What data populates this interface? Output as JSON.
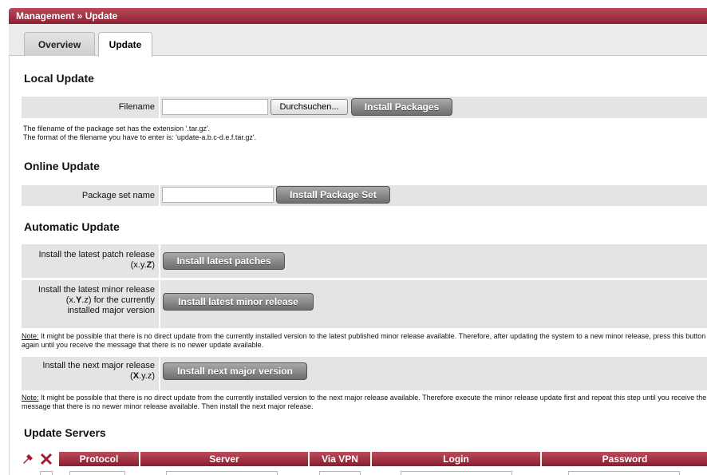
{
  "breadcrumb": "Management » Update",
  "tabs": [
    {
      "label": "Overview"
    },
    {
      "label": "Update"
    }
  ],
  "local_update": {
    "heading": "Local Update",
    "filename_label": "Filename",
    "filename_value": "",
    "browse_label": "Durchsuchen...",
    "install_label": "Install Packages",
    "help_line1": "The filename of the package set has the extension '.tar.gz'.",
    "help_line2": "The format of the filename you have to enter is: 'update-a.b.c-d.e.f.tar.gz'."
  },
  "online_update": {
    "heading": "Online Update",
    "package_label": "Package set name",
    "package_value": "",
    "install_label": "Install Package Set"
  },
  "automatic_update": {
    "heading": "Automatic Update",
    "patch": {
      "label_line1": "Install the latest patch release",
      "label_line2_pre": "(x.y.",
      "label_line2_bold": "Z",
      "label_line2_post": ")",
      "button": "Install latest patches"
    },
    "minor": {
      "label_line1": "Install the latest minor release",
      "label_line2_pre": "(x.",
      "label_line2_bold": "Y",
      "label_line2_post": ".z) for the currently",
      "label_line3": "installed major version",
      "button": "Install latest minor release"
    },
    "minor_note_prefix": "Note:",
    "minor_note_text": " It might be possible that there is no direct update from the currently installed version to the latest published minor release available. Therefore, after updating the system to a new minor release, press this button again until you receive the message that there is no newer update available.",
    "major": {
      "label_line1": "Install the next major release",
      "label_line2_pre": "(",
      "label_line2_bold": "X",
      "label_line2_post": ".y.z)",
      "button": "Install next major version"
    },
    "major_note_prefix": "Note:",
    "major_note_text": " It might be possible that there is no direct update from the currently installed version to the next major release available. Therefore execute the minor release update first and repeat this step until you receive the message that there is no newer minor release available. Then install the next major release."
  },
  "update_servers": {
    "heading": "Update Servers",
    "columns": [
      "Protocol",
      "Server",
      "Via VPN",
      "Login",
      "Password"
    ],
    "add_icon": "wrench-add-icon",
    "delete_icon": "delete-x-icon"
  },
  "colors": {
    "header_red": "#8e1f30",
    "row_grey": "#e4e4e4",
    "button_grey": "#6e6e6e"
  }
}
